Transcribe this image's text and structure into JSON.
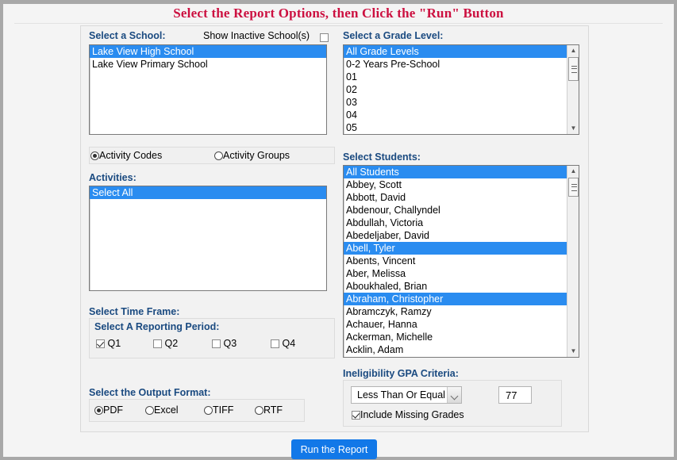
{
  "page": {
    "title": "Select the Report Options, then Click the \"Run\" Button"
  },
  "school": {
    "label": "Select a School:",
    "show_inactive_label": "Show Inactive School(s)",
    "show_inactive_checked": false,
    "items": [
      {
        "label": "Lake View High School",
        "selected": true
      },
      {
        "label": "Lake View Primary School",
        "selected": false
      }
    ]
  },
  "grade": {
    "label": "Select a Grade Level:",
    "items": [
      {
        "label": "All Grade Levels",
        "selected": true
      },
      {
        "label": "0-2 Years Pre-School",
        "selected": false
      },
      {
        "label": "01",
        "selected": false
      },
      {
        "label": "02",
        "selected": false
      },
      {
        "label": "03",
        "selected": false
      },
      {
        "label": "04",
        "selected": false
      },
      {
        "label": "05",
        "selected": false
      }
    ]
  },
  "activity_mode": {
    "options": [
      {
        "label": "Activity Codes",
        "selected": true
      },
      {
        "label": "Activity Groups",
        "selected": false
      }
    ]
  },
  "activities": {
    "label": "Activities:",
    "items": [
      {
        "label": "Select All",
        "selected": true
      }
    ]
  },
  "students": {
    "label": "Select Students:",
    "items": [
      {
        "label": "All Students",
        "selected": true
      },
      {
        "label": "Abbey, Scott",
        "selected": false
      },
      {
        "label": "Abbott, David",
        "selected": false
      },
      {
        "label": "Abdenour, Challyndel",
        "selected": false
      },
      {
        "label": "Abdullah, Victoria",
        "selected": false
      },
      {
        "label": "Abedeljaber, David",
        "selected": false
      },
      {
        "label": "Abell, Tyler",
        "selected": true
      },
      {
        "label": "Abents, Vincent",
        "selected": false
      },
      {
        "label": "Aber, Melissa",
        "selected": false
      },
      {
        "label": "Aboukhaled, Brian",
        "selected": false
      },
      {
        "label": "Abraham, Christopher",
        "selected": true
      },
      {
        "label": "Abramczyk, Ramzy",
        "selected": false
      },
      {
        "label": "Achauer, Hanna",
        "selected": false
      },
      {
        "label": "Ackerman, Michelle",
        "selected": false
      },
      {
        "label": "Acklin, Adam",
        "selected": false
      }
    ]
  },
  "time_frame": {
    "label": "Select Time Frame:",
    "reporting_period_label": "Select A Reporting Period:",
    "quarters": [
      {
        "label": "Q1",
        "checked": true
      },
      {
        "label": "Q2",
        "checked": false
      },
      {
        "label": "Q3",
        "checked": false
      },
      {
        "label": "Q4",
        "checked": false
      }
    ]
  },
  "output_format": {
    "label": "Select the Output Format:",
    "options": [
      {
        "label": "PDF",
        "selected": true
      },
      {
        "label": "Excel",
        "selected": false
      },
      {
        "label": "TIFF",
        "selected": false
      },
      {
        "label": "RTF",
        "selected": false
      }
    ]
  },
  "gpa": {
    "label": "Ineligibility GPA Criteria:",
    "comparison_value": "Less Than Or Equal To",
    "threshold_value": "77",
    "include_missing_label": "Include Missing Grades",
    "include_missing_checked": true
  },
  "footer": {
    "run_label": "Run the Report"
  },
  "colors": {
    "title": "#cc1040",
    "label": "#1a4a80",
    "selection": "#2a8cf0",
    "button": "#1278e8"
  }
}
